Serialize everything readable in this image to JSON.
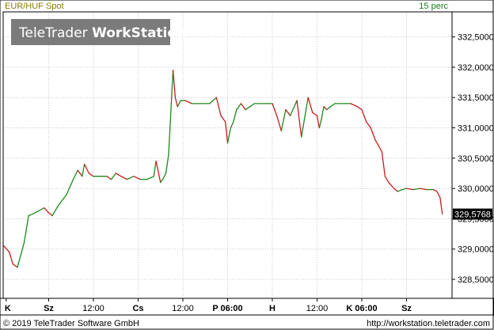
{
  "header": {
    "instrument": "EUR/HUF Spot",
    "interval": "15 perc"
  },
  "logo": {
    "brand_regular": "TeleTrader ",
    "brand_bold": "WorkStation"
  },
  "footer": {
    "copyright": "© 2019 TeleTrader Software GmbH",
    "url": "http://workstation.teletrader.com"
  },
  "colors": {
    "up": "#1a8a1a",
    "down": "#cc1a1a",
    "grid": "#c8c8c8",
    "frame": "#000000",
    "last_price_box": "#000000"
  },
  "chart_data": {
    "type": "line",
    "title": "EUR/HUF Spot",
    "interval": "15 perc",
    "ylim": [
      328.2,
      332.9
    ],
    "y_ticks": [
      328.5,
      329.0,
      329.5,
      330.0,
      330.5,
      331.0,
      331.5,
      332.0,
      332.5
    ],
    "y_tick_labels": [
      "328,5000",
      "329,0000",
      "329,5000",
      "330,0000",
      "330,5000",
      "331,0000",
      "331,5000",
      "332,0000",
      "332,5000"
    ],
    "x_tick_labels": [
      "K",
      "Sz",
      "12:00",
      "Cs",
      "12:00",
      "P 06:00",
      "H",
      "12:00",
      "K 06:00",
      "Sz"
    ],
    "x_tick_bold": [
      true,
      true,
      false,
      true,
      false,
      true,
      true,
      false,
      true,
      true
    ],
    "x_tick_pos": [
      0.005,
      0.1,
      0.2,
      0.3,
      0.4,
      0.5,
      0.6,
      0.7,
      0.8,
      0.9
    ],
    "grid": true,
    "last_value": 329.5768,
    "last_value_label": "329,5768",
    "x": [
      0.0,
      0.012,
      0.02,
      0.03,
      0.045,
      0.055,
      0.065,
      0.075,
      0.09,
      0.1,
      0.108,
      0.12,
      0.14,
      0.155,
      0.165,
      0.175,
      0.18,
      0.19,
      0.2,
      0.21,
      0.22,
      0.23,
      0.24,
      0.25,
      0.262,
      0.275,
      0.29,
      0.305,
      0.32,
      0.335,
      0.34,
      0.35,
      0.355,
      0.362,
      0.368,
      0.372,
      0.378,
      0.383,
      0.388,
      0.395,
      0.405,
      0.42,
      0.44,
      0.46,
      0.475,
      0.485,
      0.495,
      0.5,
      0.507,
      0.513,
      0.52,
      0.53,
      0.54,
      0.55,
      0.56,
      0.575,
      0.59,
      0.6,
      0.61,
      0.62,
      0.63,
      0.64,
      0.655,
      0.665,
      0.68,
      0.69,
      0.7,
      0.705,
      0.71,
      0.715,
      0.722,
      0.73,
      0.74,
      0.75,
      0.765,
      0.775,
      0.79,
      0.8,
      0.81,
      0.82,
      0.83,
      0.838,
      0.845,
      0.852,
      0.86,
      0.866,
      0.872,
      0.88,
      0.89,
      0.9,
      0.915,
      0.93,
      0.945,
      0.96,
      0.968,
      0.975,
      0.98
    ],
    "values": [
      329.05,
      328.95,
      328.75,
      328.7,
      329.1,
      329.55,
      329.58,
      329.62,
      329.68,
      329.6,
      329.55,
      329.7,
      329.9,
      330.15,
      330.3,
      330.2,
      330.4,
      330.25,
      330.2,
      330.2,
      330.2,
      330.2,
      330.15,
      330.25,
      330.2,
      330.15,
      330.2,
      330.15,
      330.15,
      330.2,
      330.45,
      330.1,
      330.15,
      330.25,
      330.55,
      331.1,
      331.95,
      331.5,
      331.35,
      331.45,
      331.45,
      331.4,
      331.4,
      331.4,
      331.5,
      331.2,
      331.1,
      330.75,
      331.0,
      331.1,
      331.3,
      331.4,
      331.3,
      331.35,
      331.4,
      331.4,
      331.4,
      331.4,
      331.2,
      330.95,
      331.3,
      331.2,
      331.45,
      330.85,
      331.5,
      331.25,
      331.2,
      331.0,
      331.15,
      331.35,
      331.3,
      331.35,
      331.4,
      331.4,
      331.4,
      331.4,
      331.35,
      331.3,
      331.1,
      331.0,
      330.8,
      330.7,
      330.6,
      330.2,
      330.1,
      330.05,
      330.0,
      329.95,
      329.98,
      330.0,
      329.98,
      330.0,
      329.98,
      329.98,
      329.95,
      329.85,
      329.58
    ]
  }
}
